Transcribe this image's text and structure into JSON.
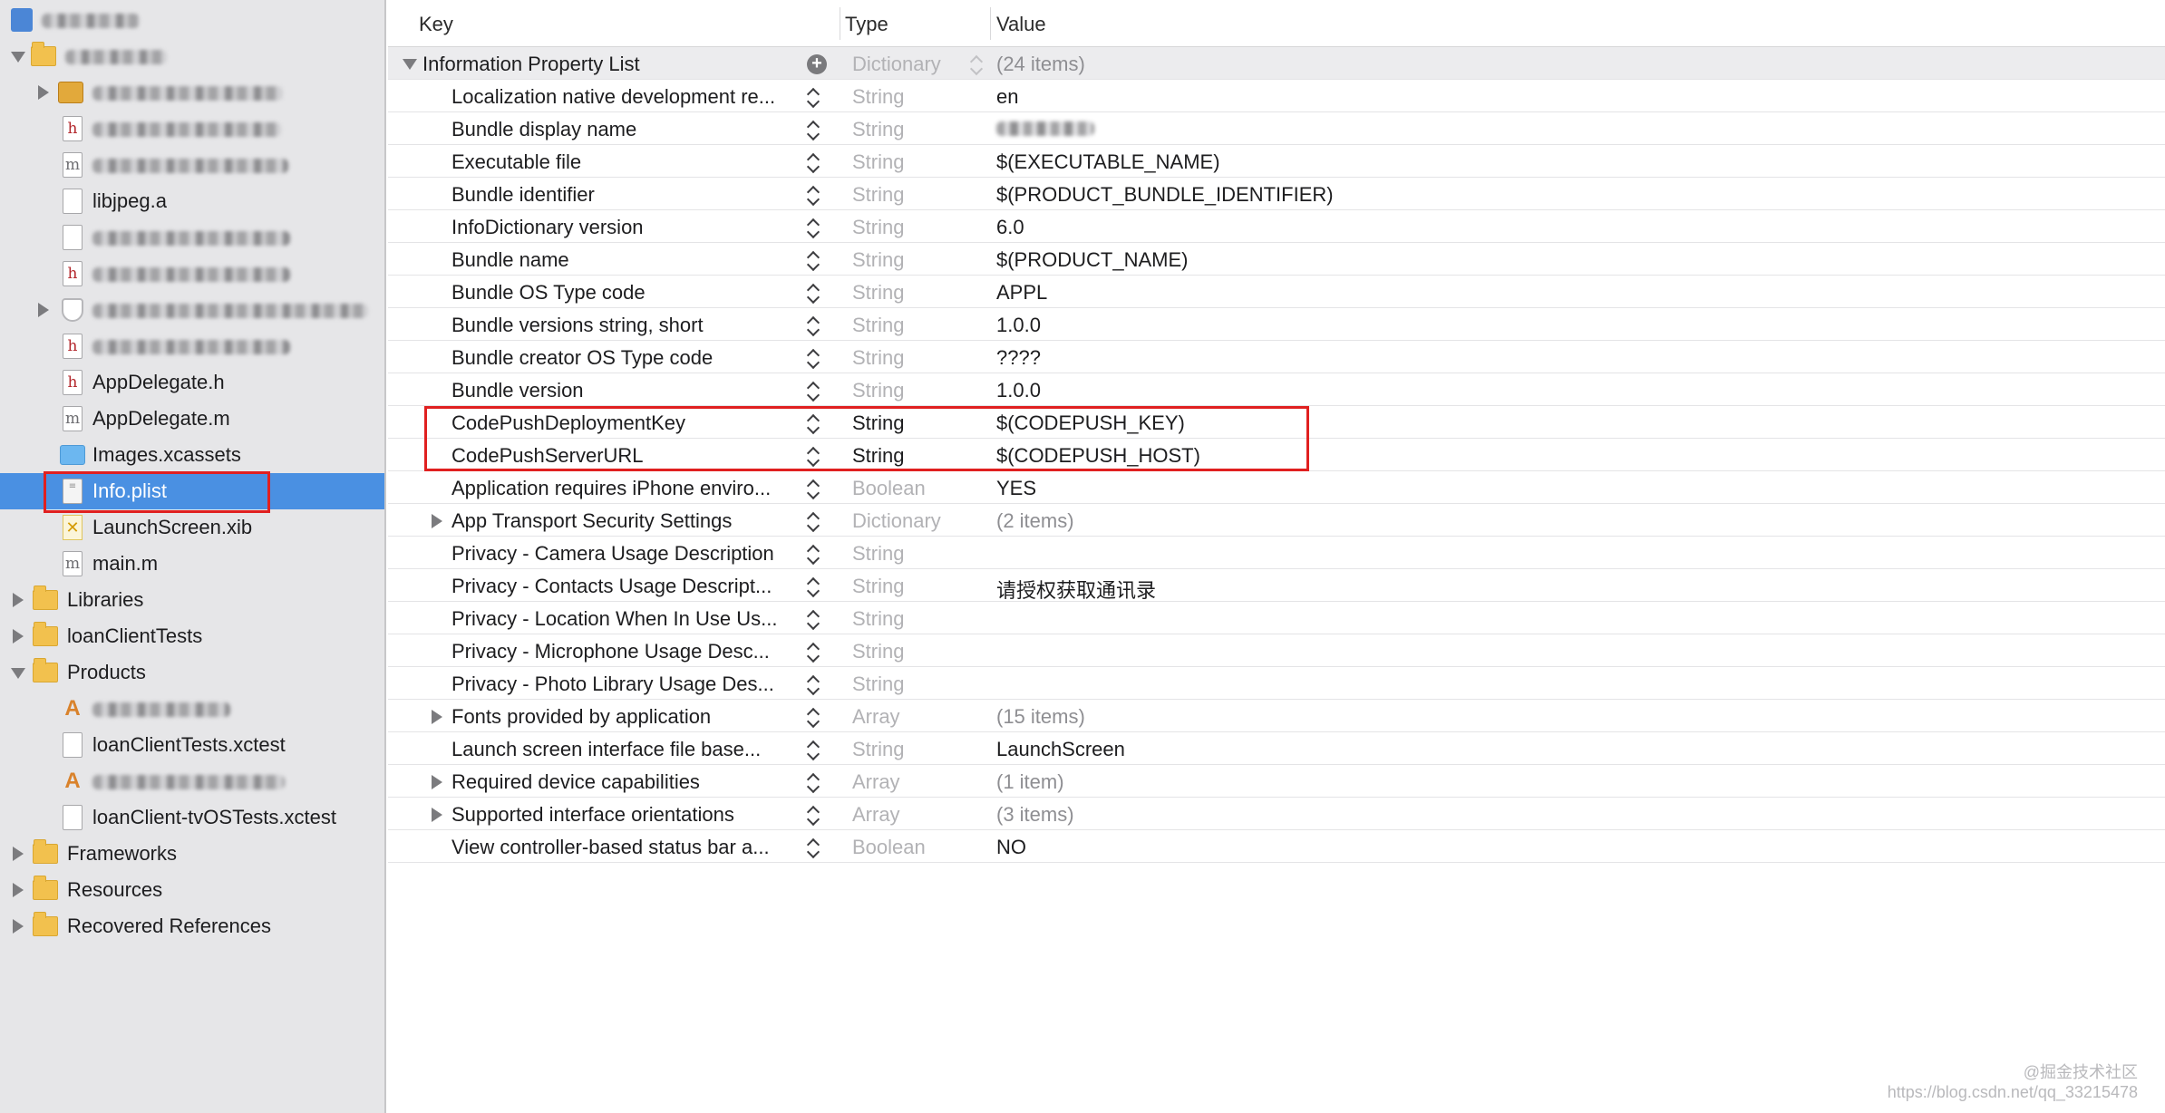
{
  "sidebar": {
    "items": [
      {
        "label": "",
        "redacted": true,
        "icon": "project-icon"
      },
      {
        "label": "",
        "redacted": true,
        "icon": "folder-icon"
      },
      {
        "label": "",
        "redacted": true,
        "icon": "toolbox-icon"
      },
      {
        "label": "",
        "redacted": true,
        "icon": "header-file-icon"
      },
      {
        "label": "",
        "redacted": true,
        "icon": "implementation-file-icon"
      },
      {
        "label": "libjpeg.a",
        "icon": "library-file-icon"
      },
      {
        "label": "",
        "redacted": true,
        "icon": "file-icon"
      },
      {
        "label": "",
        "redacted": true,
        "icon": "header-file-icon"
      },
      {
        "label": "",
        "redacted": true,
        "icon": "shield-icon"
      },
      {
        "label": "",
        "redacted": true,
        "icon": "header-file-icon"
      },
      {
        "label": "AppDelegate.h",
        "icon": "header-file-icon"
      },
      {
        "label": "AppDelegate.m",
        "icon": "implementation-file-icon"
      },
      {
        "label": "Images.xcassets",
        "icon": "asset-catalog-icon"
      },
      {
        "label": "Info.plist",
        "icon": "plist-file-icon",
        "selected": true
      },
      {
        "label": "LaunchScreen.xib",
        "icon": "xib-file-icon"
      },
      {
        "label": "main.m",
        "icon": "implementation-file-icon"
      },
      {
        "label": "Libraries",
        "icon": "folder-icon"
      },
      {
        "label": "loanClientTests",
        "icon": "folder-icon"
      },
      {
        "label": "Products",
        "icon": "folder-icon"
      },
      {
        "label": "",
        "redacted": true,
        "icon": "app-icon"
      },
      {
        "label": "loanClientTests.xctest",
        "icon": "xctest-icon"
      },
      {
        "label": "",
        "redacted": true,
        "icon": "app-icon"
      },
      {
        "label": "loanClient-tvOSTests.xctest",
        "icon": "xctest-icon"
      },
      {
        "label": "Frameworks",
        "icon": "folder-icon"
      },
      {
        "label": "Resources",
        "icon": "folder-icon"
      },
      {
        "label": "Recovered References",
        "icon": "folder-icon"
      }
    ]
  },
  "plist": {
    "headers": {
      "key": "Key",
      "type": "Type",
      "value": "Value"
    },
    "root": {
      "key": "Information Property List",
      "type": "Dictionary",
      "value": "(24 items)"
    },
    "rows": [
      {
        "key": "Localization native development re...",
        "type": "String",
        "value": "en"
      },
      {
        "key": "Bundle display name",
        "type": "String",
        "value": "",
        "redacted": true
      },
      {
        "key": "Executable file",
        "type": "String",
        "value": "$(EXECUTABLE_NAME)"
      },
      {
        "key": "Bundle identifier",
        "type": "String",
        "value": "$(PRODUCT_BUNDLE_IDENTIFIER)"
      },
      {
        "key": "InfoDictionary version",
        "type": "String",
        "value": "6.0"
      },
      {
        "key": "Bundle name",
        "type": "String",
        "value": "$(PRODUCT_NAME)"
      },
      {
        "key": "Bundle OS Type code",
        "type": "String",
        "value": "APPL"
      },
      {
        "key": "Bundle versions string, short",
        "type": "String",
        "value": "1.0.0"
      },
      {
        "key": "Bundle creator OS Type code",
        "type": "String",
        "value": "????"
      },
      {
        "key": "Bundle version",
        "type": "String",
        "value": "1.0.0"
      },
      {
        "key": "CodePushDeploymentKey",
        "type": "String",
        "value": "$(CODEPUSH_KEY)",
        "highlight": true
      },
      {
        "key": "CodePushServerURL",
        "type": "String",
        "value": "$(CODEPUSH_HOST)",
        "highlight": true
      },
      {
        "key": "Application requires iPhone enviro...",
        "type": "Boolean",
        "value": "YES"
      },
      {
        "key": "App Transport Security Settings",
        "type": "Dictionary",
        "value": "(2 items)",
        "expandable": true
      },
      {
        "key": "Privacy - Camera Usage Description",
        "type": "String",
        "value": ""
      },
      {
        "key": "Privacy - Contacts Usage Descript...",
        "type": "String",
        "value": "请授权获取通讯录"
      },
      {
        "key": "Privacy - Location When In Use Us...",
        "type": "String",
        "value": ""
      },
      {
        "key": "Privacy - Microphone Usage Desc...",
        "type": "String",
        "value": ""
      },
      {
        "key": "Privacy - Photo Library Usage Des...",
        "type": "String",
        "value": ""
      },
      {
        "key": "Fonts provided by application",
        "type": "Array",
        "value": "(15 items)",
        "expandable": true
      },
      {
        "key": "Launch screen interface file base...",
        "type": "String",
        "value": "LaunchScreen"
      },
      {
        "key": "Required device capabilities",
        "type": "Array",
        "value": "(1 item)",
        "expandable": true
      },
      {
        "key": "Supported interface orientations",
        "type": "Array",
        "value": "(3 items)",
        "expandable": true
      },
      {
        "key": "View controller-based status bar a...",
        "type": "Boolean",
        "value": "NO"
      }
    ]
  },
  "watermark": {
    "line1": "@掘金技术社区",
    "line2": "https://blog.csdn.net/qq_33215478"
  },
  "colors": {
    "selection": "#4a90e2",
    "highlight_box": "#e02020",
    "sidebar_bg": "#e6e6e8"
  }
}
